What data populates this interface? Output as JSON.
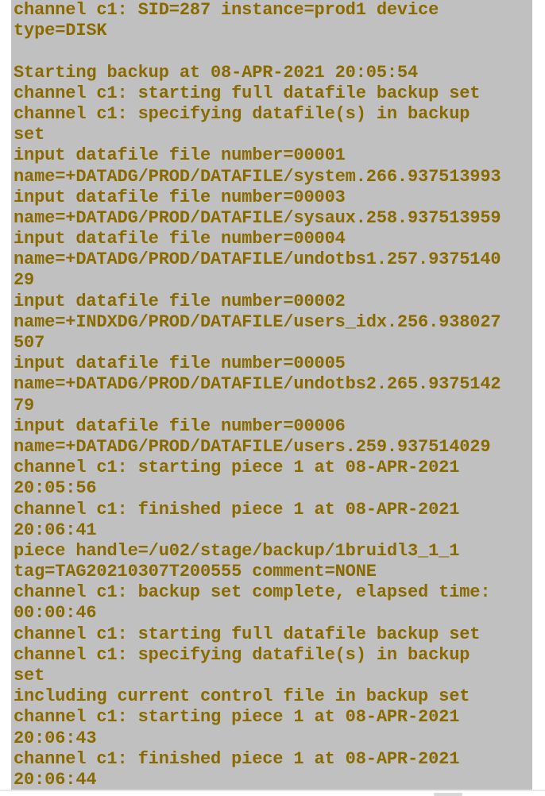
{
  "colors": {
    "background": "#c0c0c0",
    "text": "#8a6a00"
  },
  "console": {
    "lines": [
      "channel c1: SID=287 instance=prod1 device",
      "type=DISK",
      "",
      "Starting backup at 08-APR-2021 20:05:54",
      "channel c1: starting full datafile backup set",
      "channel c1: specifying datafile(s) in backup",
      "set",
      "input datafile file number=00001",
      "name=+DATADG/PROD/DATAFILE/system.266.937513993",
      "input datafile file number=00003",
      "name=+DATADG/PROD/DATAFILE/sysaux.258.937513959",
      "input datafile file number=00004",
      "name=+DATADG/PROD/DATAFILE/undotbs1.257.9375140",
      "29",
      "input datafile file number=00002",
      "name=+INDXDG/PROD/DATAFILE/users_idx.256.938027",
      "507",
      "input datafile file number=00005",
      "name=+DATADG/PROD/DATAFILE/undotbs2.265.9375142",
      "79",
      "input datafile file number=00006",
      "name=+DATADG/PROD/DATAFILE/users.259.937514029",
      "channel c1: starting piece 1 at 08-APR-2021",
      "20:05:56",
      "channel c1: finished piece 1 at 08-APR-2021",
      "20:06:41",
      "piece handle=/u02/stage/backup/1bruidl3_1_1",
      "tag=TAG20210307T200555 comment=NONE",
      "channel c1: backup set complete, elapsed time:",
      "00:00:46",
      "channel c1: starting full datafile backup set",
      "channel c1: specifying datafile(s) in backup",
      "set",
      "including current control file in backup set",
      "channel c1: starting piece 1 at 08-APR-2021",
      "20:06:43",
      "channel c1: finished piece 1 at 08-APR-2021",
      "20:06:44"
    ]
  }
}
